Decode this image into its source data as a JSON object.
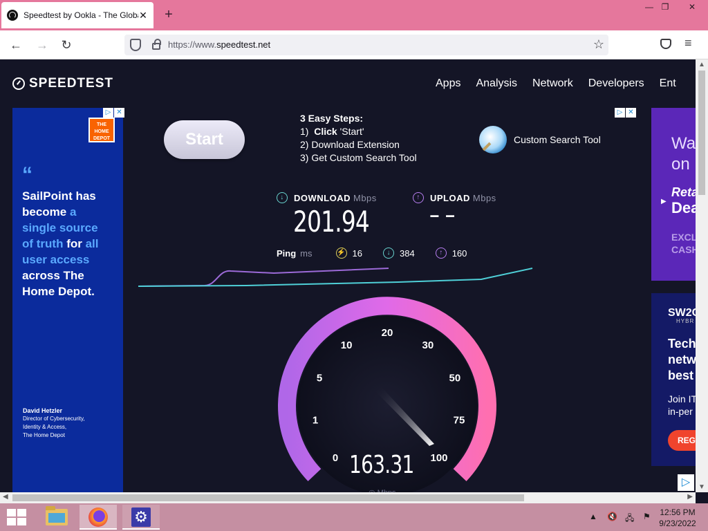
{
  "browser": {
    "tab_title": "Speedtest by Ookla - The Global Broadband Speed Test",
    "tab_close": "✕",
    "new_tab": "+",
    "url_prefix": "https://www.",
    "url_domain": "speedtest.net",
    "window_min": "—",
    "window_max": "❐",
    "window_close": "✕"
  },
  "site": {
    "logo": "SPEEDTEST",
    "nav": [
      "Apps",
      "Analysis",
      "Network",
      "Developers",
      "Ent"
    ]
  },
  "ad_left": {
    "quote": "“",
    "line1": "SailPoint has",
    "line2a": "become ",
    "line2b": "a",
    "line3": "single source",
    "line4a": "of truth ",
    "line4b": "for ",
    "line4c": "all",
    "line5": "user access",
    "line6": "across The",
    "line7": "Home Depot.",
    "author_name": "David Hetzler",
    "author_title1": "Director of Cybersecurity,",
    "author_title2": "Identity & Access,",
    "author_title3": "The Home Depot",
    "brand_logo": "THE HOME DEPOT"
  },
  "ad_inline": {
    "start": "Start",
    "steps_title": "3 Easy Steps:",
    "step1_num": "1)",
    "step1_bold": "Click",
    "step1_rest": " 'Start'",
    "step2": "2)  Download Extension",
    "step3": "3)  Get Custom Search Tool",
    "tool_label": "Custom Search Tool"
  },
  "ad_right_top": {
    "line1": "Wa",
    "line2": "on",
    "retail": "Reta",
    "deals": "Dea",
    "exclu1": "EXCL",
    "exclu2": "CASH"
  },
  "ad_right_bottom": {
    "brand": "SW2C",
    "hybrid": "HYBR",
    "head1": "Tech",
    "head2": "netw",
    "head3": "best",
    "sub1": "Join IT",
    "sub2": "in-per",
    "cta": "REG"
  },
  "results": {
    "download_label": "DOWNLOAD",
    "download_unit": "Mbps",
    "download_value": "201.94",
    "upload_label": "UPLOAD",
    "upload_unit": "Mbps",
    "upload_value": "– –",
    "ping_label": "Ping",
    "ping_unit": "ms",
    "ping_idle": "16",
    "ping_down": "384",
    "ping_up": "160"
  },
  "gauge": {
    "ticks": [
      "0",
      "1",
      "5",
      "10",
      "20",
      "30",
      "50",
      "75",
      "100"
    ],
    "current_value": "163.31",
    "max": 100
  },
  "taskbar": {
    "time": "12:56 PM",
    "date": "9/23/2022"
  },
  "colors": {
    "page_bg": "#141526",
    "titlebar": "#e5779c",
    "taskbar": "#c58fa2",
    "download": "#69d4cf",
    "upload": "#b77ef0",
    "ping": "#dbcf5c"
  }
}
